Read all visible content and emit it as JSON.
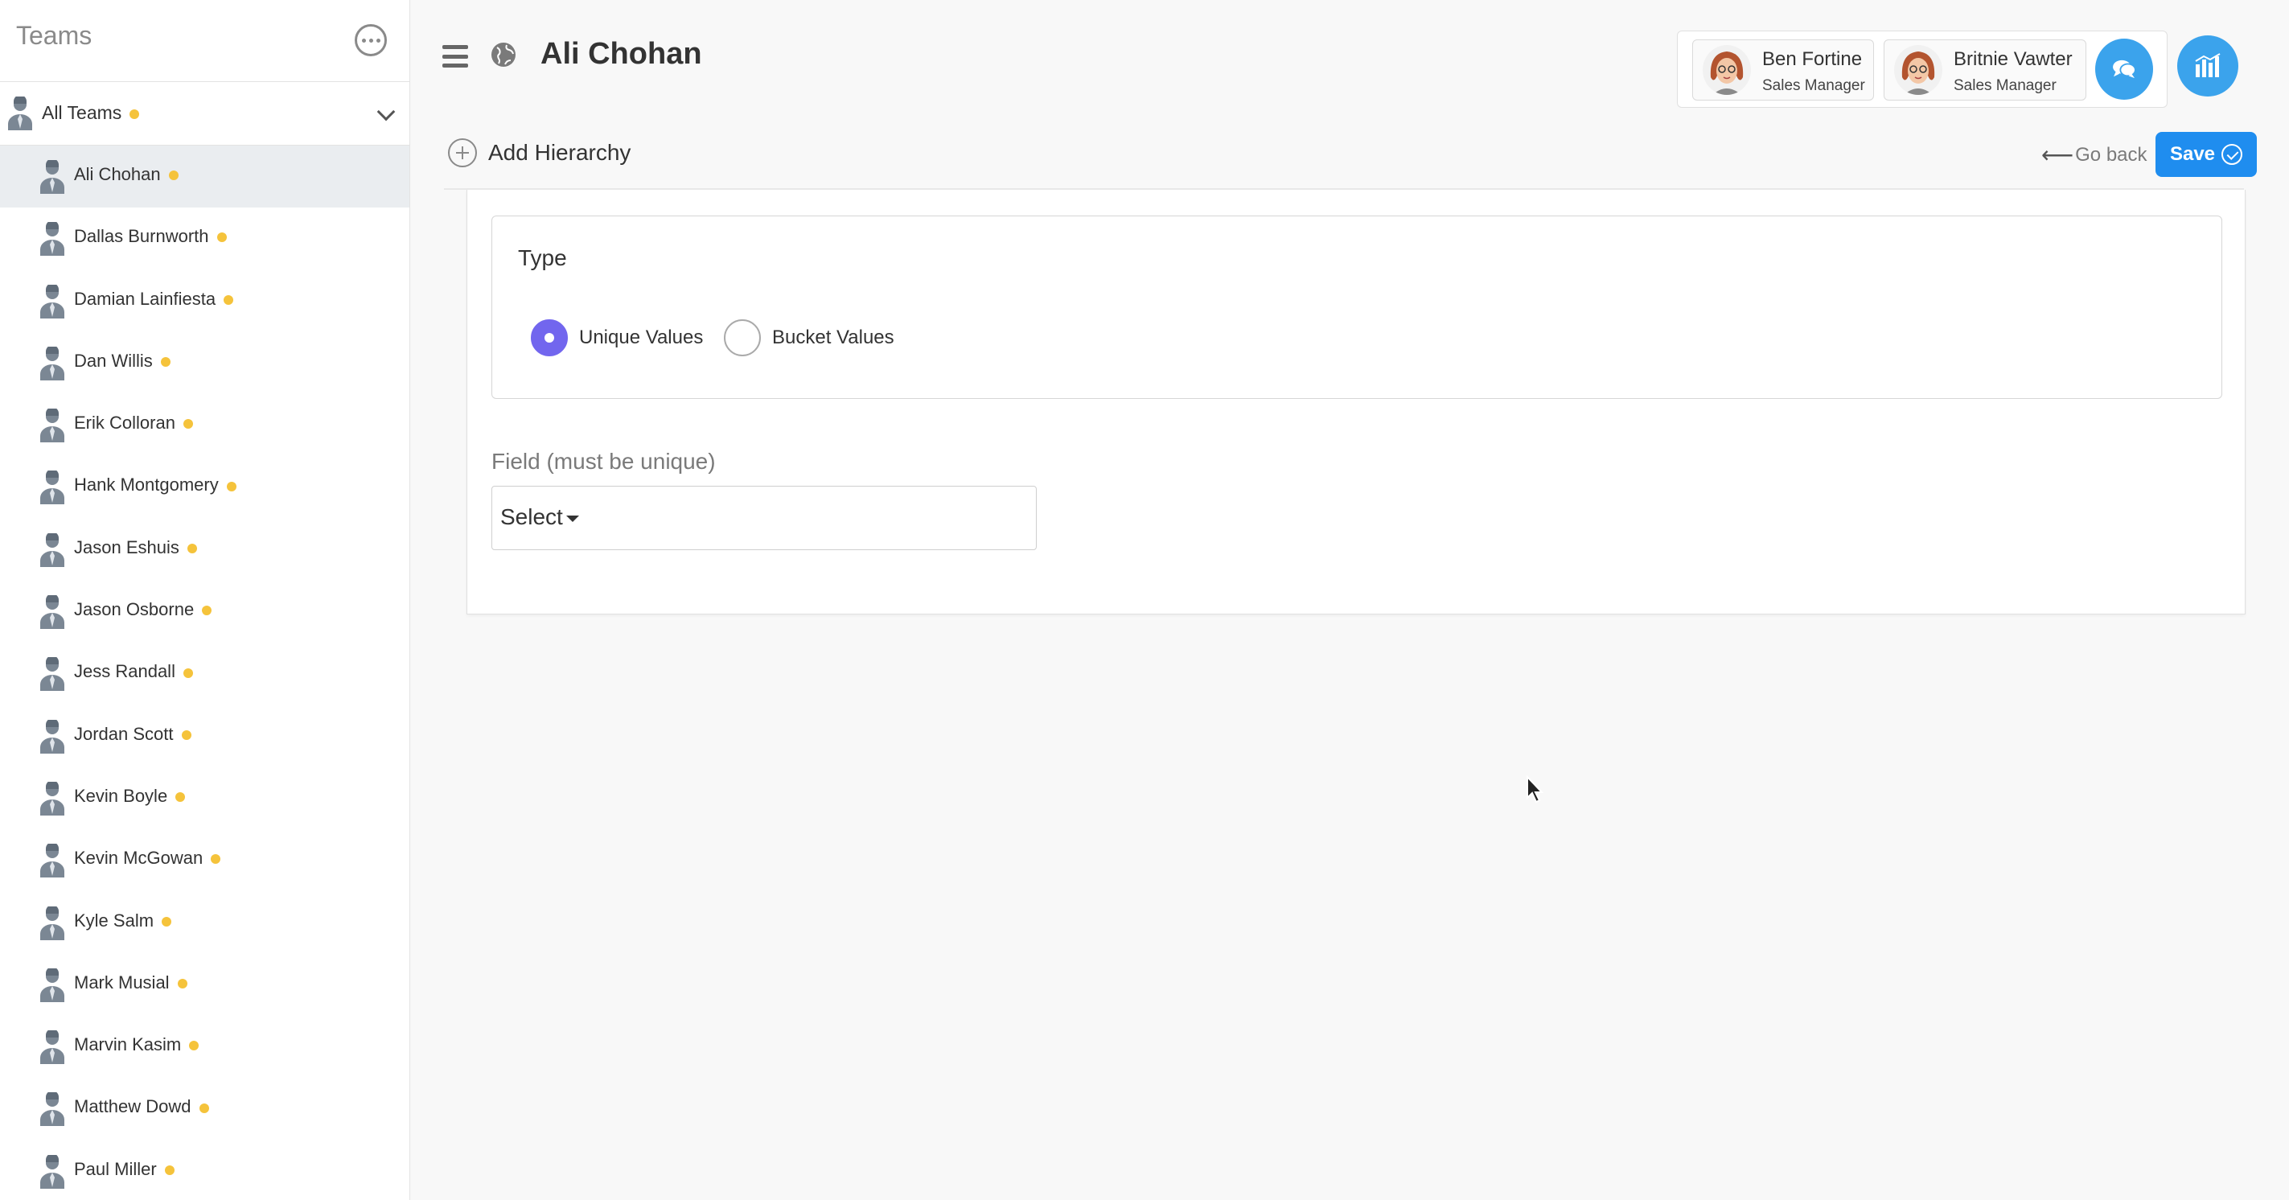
{
  "sidebar": {
    "title": "Teams",
    "all_teams_label": "All Teams",
    "members": [
      {
        "name": "Ali Chohan",
        "active": true
      },
      {
        "name": "Dallas Burnworth"
      },
      {
        "name": "Damian Lainfiesta"
      },
      {
        "name": "Dan Willis"
      },
      {
        "name": "Erik Colloran"
      },
      {
        "name": "Hank Montgomery"
      },
      {
        "name": "Jason Eshuis"
      },
      {
        "name": "Jason Osborne"
      },
      {
        "name": "Jess Randall"
      },
      {
        "name": "Jordan Scott"
      },
      {
        "name": "Kevin Boyle"
      },
      {
        "name": "Kevin McGowan"
      },
      {
        "name": "Kyle Salm"
      },
      {
        "name": "Mark Musial"
      },
      {
        "name": "Marvin Kasim"
      },
      {
        "name": "Matthew Dowd"
      },
      {
        "name": "Paul Miller"
      }
    ]
  },
  "header": {
    "title": "Ali Chohan",
    "managers": [
      {
        "name": "Ben Fortine",
        "role": "Sales Manager"
      },
      {
        "name": "Britnie Vawter",
        "role": "Sales Manager"
      }
    ]
  },
  "actions": {
    "add_hierarchy": "Add Hierarchy",
    "go_back": "Go back",
    "go_back_arrow": "⟵",
    "save": "Save"
  },
  "form": {
    "type_label": "Type",
    "options": [
      {
        "label": "Unique Values",
        "checked": true
      },
      {
        "label": "Bucket Values",
        "checked": false
      }
    ],
    "field_label": "Field (must be unique)",
    "select_value": "Select"
  },
  "colors": {
    "accent": "#3ba3ec",
    "save": "#1f8def",
    "radio_checked": "#7266ee",
    "status_dot": "#f5c33b"
  }
}
